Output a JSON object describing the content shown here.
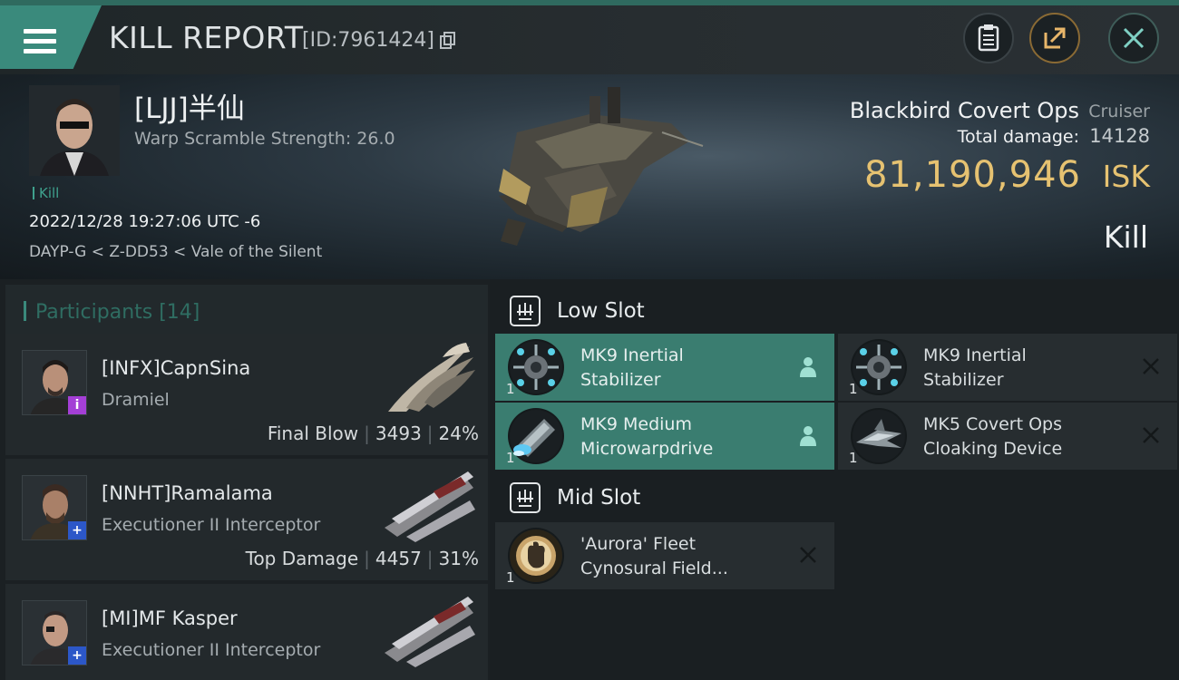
{
  "header": {
    "title": "KILL REPORT",
    "report_id": "[ID:7961424]"
  },
  "victim": {
    "name": "[LJJ]半仙",
    "warp_scramble": "Warp Scramble Strength: 26.0",
    "tag": "Kill",
    "datetime": "2022/12/28 19:27:06 UTC -6",
    "location": "DAYP-G < Z-DD53 < Vale of the Silent"
  },
  "ship": {
    "name": "Blackbird Covert Ops",
    "class": "Cruiser",
    "total_damage_label": "Total damage:",
    "total_damage": "14128",
    "isk_value": "81,190,946",
    "isk_unit": "ISK",
    "result": "Kill"
  },
  "participants": {
    "title": "Participants [14]",
    "rows": [
      {
        "name": "[INFX]CapnSina",
        "ship": "Dramiel",
        "role": "Final Blow",
        "damage": "3493",
        "percent": "24%",
        "badge": "i",
        "badge_color": "#a43fd6"
      },
      {
        "name": "[NNHT]Ramalama",
        "ship": "Executioner II Interceptor",
        "role": "Top Damage",
        "damage": "4457",
        "percent": "31%",
        "badge": "+",
        "badge_color": "#2c57c8"
      },
      {
        "name": "[MI]MF Kasper",
        "ship": "Executioner II Interceptor",
        "role": "",
        "damage": "",
        "percent": "",
        "badge": "+",
        "badge_color": "#2c57c8"
      }
    ]
  },
  "slots": {
    "low_label": "Low Slot",
    "mid_label": "Mid Slot",
    "low": [
      {
        "name_line1": "MK9 Inertial",
        "name_line2": "Stabilizer",
        "qty": "1",
        "status": "fitted"
      },
      {
        "name_line1": "MK9 Inertial",
        "name_line2": "Stabilizer",
        "qty": "1",
        "status": "destroyed"
      },
      {
        "name_line1": "MK9 Medium",
        "name_line2": "Microwarpdrive",
        "qty": "1",
        "status": "fitted"
      },
      {
        "name_line1": "MK5 Covert Ops",
        "name_line2": "Cloaking Device",
        "qty": "1",
        "status": "destroyed"
      }
    ],
    "mid": [
      {
        "name_line1": "'Aurora' Fleet",
        "name_line2": "Cynosural Field...",
        "qty": "1",
        "status": "destroyed"
      }
    ]
  },
  "colors": {
    "accent": "#3a8a7c",
    "isk": "#e6c271",
    "fitted_bg": "#3a7d70"
  }
}
